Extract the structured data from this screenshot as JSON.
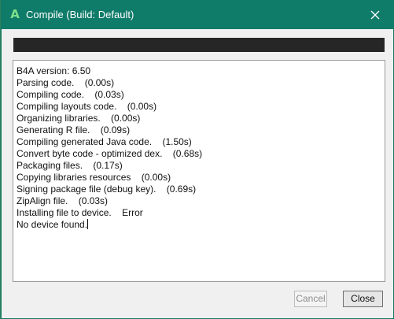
{
  "window": {
    "title": "Compile (Build: Default)",
    "app_icon_letter": "A",
    "close_icon": "close-icon",
    "colors": {
      "titlebar": "#0f7b69",
      "progress_bar": "#262626"
    }
  },
  "progress": {
    "value_percent": 100
  },
  "log": {
    "lines": [
      "B4A version: 6.50",
      "Parsing code.    (0.00s)",
      "Compiling code.    (0.03s)",
      "Compiling layouts code.    (0.00s)",
      "Organizing libraries.    (0.00s)",
      "Generating R file.    (0.09s)",
      "Compiling generated Java code.    (1.50s)",
      "Convert byte code - optimized dex.    (0.68s)",
      "Packaging files.    (0.17s)",
      "Copying libraries resources    (0.00s)",
      "Signing package file (debug key).    (0.69s)",
      "ZipAlign file.    (0.03s)",
      "Installing file to device.    Error",
      "No device found."
    ]
  },
  "buttons": {
    "cancel_label": "Cancel",
    "close_label": "Close"
  }
}
